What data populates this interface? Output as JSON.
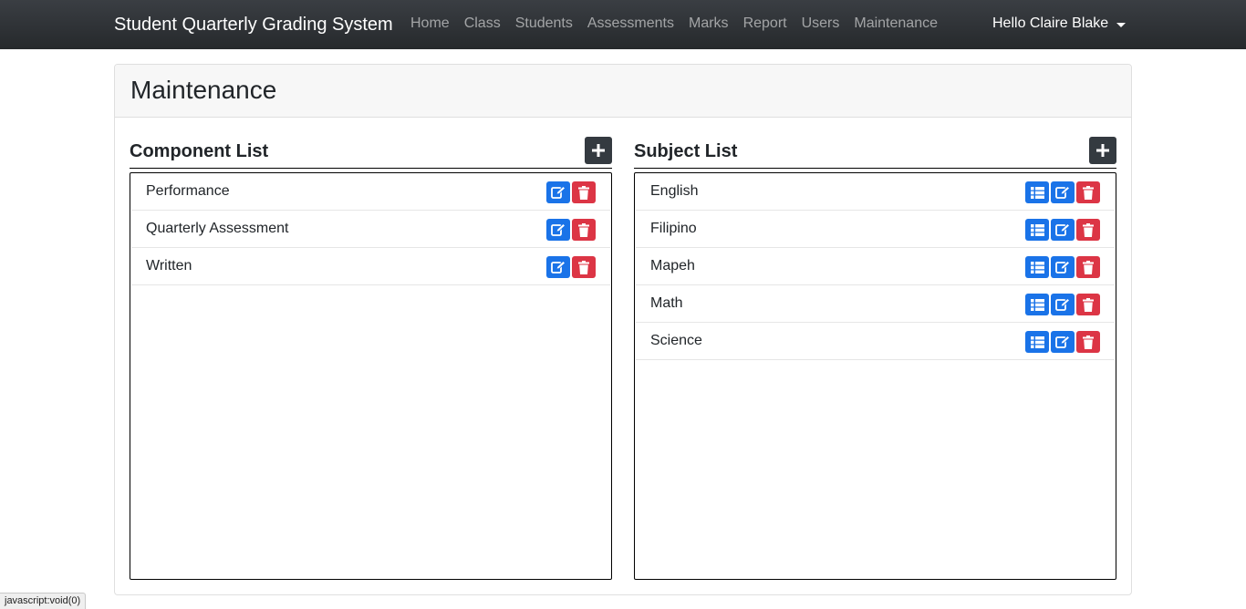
{
  "navbar": {
    "brand": "Student Quarterly Grading System",
    "links": [
      "Home",
      "Class",
      "Students",
      "Assessments",
      "Marks",
      "Report",
      "Users",
      "Maintenance"
    ],
    "user_greeting": "Hello Claire Blake"
  },
  "page": {
    "title": "Maintenance"
  },
  "component_list": {
    "title": "Component List",
    "items": [
      "Performance",
      "Quarterly Assessment",
      "Written"
    ]
  },
  "subject_list": {
    "title": "Subject List",
    "items": [
      "English",
      "Filipino",
      "Mapeh",
      "Math",
      "Science"
    ]
  },
  "status_bar": {
    "text": "javascript:void(0)"
  },
  "colors": {
    "navbar": "#2c2f33",
    "primary": "#1a73e8",
    "danger": "#dc3545",
    "dark": "#343a40"
  },
  "icons": {
    "add": "plus-icon",
    "edit": "edit-icon",
    "delete": "trash-icon",
    "list": "list-icon"
  }
}
